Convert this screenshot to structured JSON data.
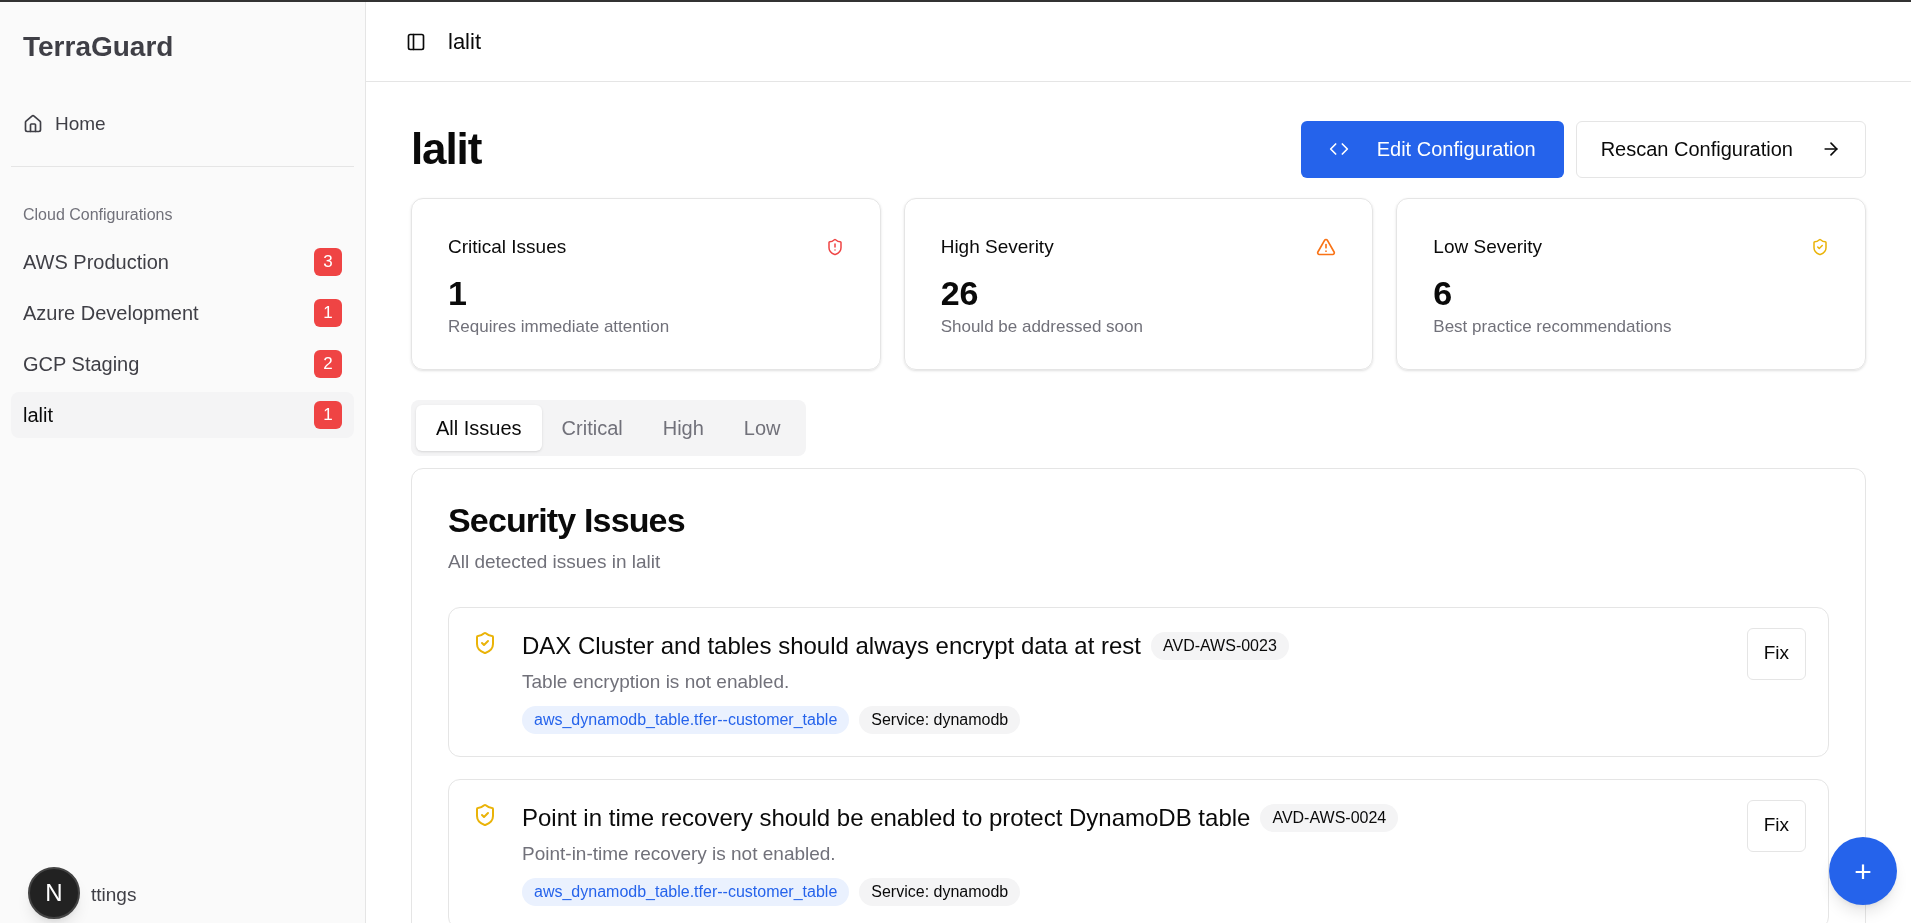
{
  "sidebar": {
    "brand": "TerraGuard",
    "home": "Home",
    "section_label": "Cloud Configurations",
    "items": [
      {
        "label": "AWS Production",
        "count": "3",
        "selected": false
      },
      {
        "label": "Azure Development",
        "count": "1",
        "selected": false
      },
      {
        "label": "GCP Staging",
        "count": "2",
        "selected": false
      },
      {
        "label": "lalit",
        "count": "1",
        "selected": true
      }
    ],
    "settings_partial": "ttings"
  },
  "topbar": {
    "title": "lalit"
  },
  "page": {
    "title": "lalit",
    "buttons": [
      {
        "kind": "primary",
        "label": "Edit Configuration"
      },
      {
        "kind": "outline",
        "label": "Rescan Configuration"
      }
    ]
  },
  "stats": [
    {
      "kind": "critical",
      "title": "Critical Issues",
      "value": "1",
      "caption": "Requires immediate attention"
    },
    {
      "kind": "high",
      "title": "High Severity",
      "value": "26",
      "caption": "Should be addressed soon"
    },
    {
      "kind": "low",
      "title": "Low Severity",
      "value": "6",
      "caption": "Best practice recommendations"
    }
  ],
  "tabs": [
    {
      "label": "All Issues",
      "selected": true
    },
    {
      "label": "Critical",
      "selected": false
    },
    {
      "label": "High",
      "selected": false
    },
    {
      "label": "Low",
      "selected": false
    }
  ],
  "issues_panel": {
    "title": "Security Issues",
    "subtitle": "All detected issues in lalit",
    "issues": [
      {
        "kind": "low",
        "title": "DAX Cluster and tables should always encrypt data at rest",
        "code": "AVD-AWS-0023",
        "description": "Table encryption is not enabled.",
        "resource": "aws_dynamodb_table.tfer--customer_table",
        "service": "Service: dynamodb",
        "action": "Fix"
      },
      {
        "kind": "low",
        "title": "Point in time recovery should be enabled to protect DynamoDB table",
        "code": "AVD-AWS-0024",
        "description": "Point-in-time recovery is not enabled.",
        "resource": "aws_dynamodb_table.tfer--customer_table",
        "service": "Service: dynamodb",
        "action": "Fix"
      }
    ]
  },
  "dev_badge": {
    "letter": "N"
  },
  "fab": {
    "symbol": "+"
  }
}
